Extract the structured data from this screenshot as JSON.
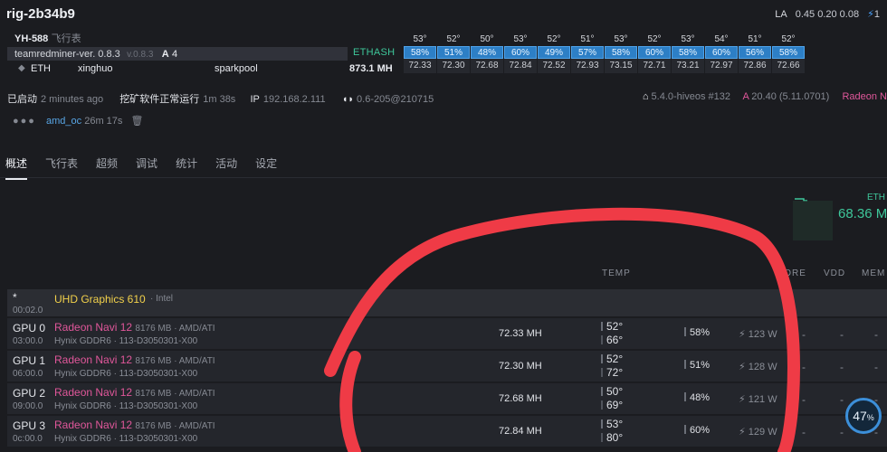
{
  "header": {
    "rig_name": "rig-2b34b9",
    "la_label": "LA",
    "la_values": "0.45 0.20 0.08",
    "la_extra": "1"
  },
  "miner": {
    "worker": "YH-588",
    "flight_sheet": "飞行表",
    "miner_name": "teamredminer-ver. 0.8.3",
    "miner_version": "v.0.8.3",
    "amd_label": "A",
    "amd_count": "4",
    "algo": "ETHASH",
    "coin": "ETH",
    "wallet": "xinghuo",
    "pool": "sparkpool",
    "hashrate": "873.1 MH"
  },
  "gpu_summary": [
    {
      "temp": "53°",
      "fan": "58%",
      "hash": "72.33"
    },
    {
      "temp": "52°",
      "fan": "51%",
      "hash": "72.30"
    },
    {
      "temp": "50°",
      "fan": "48%",
      "hash": "72.68"
    },
    {
      "temp": "53°",
      "fan": "60%",
      "hash": "72.84"
    },
    {
      "temp": "52°",
      "fan": "49%",
      "hash": "72.52"
    },
    {
      "temp": "51°",
      "fan": "57%",
      "hash": "72.93"
    },
    {
      "temp": "53°",
      "fan": "58%",
      "hash": "73.15"
    },
    {
      "temp": "52°",
      "fan": "60%",
      "hash": "72.71"
    },
    {
      "temp": "53°",
      "fan": "58%",
      "hash": "73.21"
    },
    {
      "temp": "54°",
      "fan": "60%",
      "hash": "72.97"
    },
    {
      "temp": "51°",
      "fan": "56%",
      "hash": "72.86"
    },
    {
      "temp": "52°",
      "fan": "58%",
      "hash": "72.66"
    }
  ],
  "status": {
    "started_label": "已启动",
    "started_value": "2 minutes ago",
    "running_label": "挖矿软件正常运行",
    "running_value": "1m 38s",
    "ip_label": "IP",
    "ip_value": "192.168.2.111",
    "version": "0.6-205@210715",
    "kernel": "5.4.0-hiveos #132",
    "amd_driver_label": "A",
    "amd_driver": "20.40 (5.11.0701)",
    "gpu_brand": "Radeon N"
  },
  "flight": {
    "name": "amd_oc",
    "age": "26m",
    "age2": "17s"
  },
  "tabs": [
    {
      "label": "概述"
    },
    {
      "label": "飞行表"
    },
    {
      "label": "超频"
    },
    {
      "label": "调试"
    },
    {
      "label": "统计"
    },
    {
      "label": "活动"
    },
    {
      "label": "设定"
    }
  ],
  "overview": {
    "coin_label": "ETH",
    "total_rate": "68.36 M"
  },
  "columns": {
    "temp": "TEMP",
    "core": "CORE",
    "vdd": "VDD",
    "mem": "MEM"
  },
  "igpu": {
    "star": "*",
    "name": "UHD Graphics 610",
    "vendor": "· Intel",
    "time": "00:02.0"
  },
  "gpus": [
    {
      "id": "GPU 0",
      "time": "03:00.0",
      "name": "Radeon Navi 12",
      "spec": "8176 MB · AMD/ATI",
      "mem": "Hynix GDDR6 · 113-D3050301-X00",
      "hash": "72.33 MH",
      "temp": "52°",
      "mem_temp": "66°",
      "fan": "58%",
      "power": "123 W",
      "d1": "-",
      "d2": "-",
      "d3": "-"
    },
    {
      "id": "GPU 1",
      "time": "06:00.0",
      "name": "Radeon Navi 12",
      "spec": "8176 MB · AMD/ATI",
      "mem": "Hynix GDDR6 · 113-D3050301-X00",
      "hash": "72.30 MH",
      "temp": "52°",
      "mem_temp": "72°",
      "fan": "51%",
      "power": "128 W",
      "d1": "-",
      "d2": "-",
      "d3": "-"
    },
    {
      "id": "GPU 2",
      "time": "09:00.0",
      "name": "Radeon Navi 12",
      "spec": "8176 MB · AMD/ATI",
      "mem": "Hynix GDDR6 · 113-D3050301-X00",
      "hash": "72.68 MH",
      "temp": "50°",
      "mem_temp": "69°",
      "fan": "48%",
      "power": "121 W",
      "d1": "-",
      "d2": "-",
      "d3": "-"
    },
    {
      "id": "GPU 3",
      "time": "0c:00.0",
      "name": "Radeon Navi 12",
      "spec": "8176 MB · AMD/ATI",
      "mem": "Hynix GDDR6 · 113-D3050301-X00",
      "hash": "72.84 MH",
      "temp": "53°",
      "mem_temp": "80°",
      "fan": "60%",
      "power": "129 W",
      "d1": "-",
      "d2": "-",
      "d3": "-"
    }
  ],
  "badge": {
    "value": "47",
    "unit": "%"
  },
  "colors": {
    "accent_green": "#3ec79a",
    "gpu_pink": "#e0579a",
    "fan_blue": "#2d7fc6",
    "annotation_red": "#ef3b46"
  }
}
